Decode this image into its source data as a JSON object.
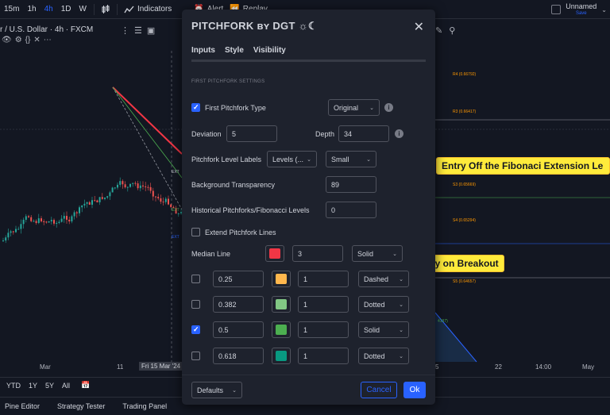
{
  "toolbar": {
    "timeframes": [
      "15m",
      "1h",
      "4h",
      "1D",
      "W"
    ],
    "active_timeframe": "4h",
    "indicators_label": "Indicators",
    "alert_label": "Alert",
    "replay_label": "Replay",
    "layout_name": "Unnamed",
    "layout_status": "Save"
  },
  "chart": {
    "symbol": "r / U.S. Dollar · 4h · FXCM",
    "levels": [
      {
        "label": "R4 (0.66792)",
        "color": "orange"
      },
      {
        "label": "R3 (0.66417)",
        "color": "orange"
      },
      {
        "label": "S3 (0.65669)",
        "color": "orange"
      },
      {
        "label": "S4 (0.65294)",
        "color": "orange"
      },
      {
        "label": "S5 (0.64657)",
        "color": "orange"
      },
      {
        "label": "4197)",
        "color": "green"
      }
    ],
    "pitchfork_labels": [
      "EXT",
      "EXT",
      "EXT"
    ],
    "notes": {
      "entry_off": "Entry Off the Fibonaci Extension Le",
      "entry_breakout": "try on Breakout"
    },
    "x_axis": [
      "Mar",
      "11",
      "Fri 15 Mar '24",
      "5",
      "22",
      "14:00",
      "May"
    ],
    "range_buttons": [
      "YTD",
      "1Y",
      "5Y",
      "All"
    ]
  },
  "bottom_panels": [
    "Pine Editor",
    "Strategy Tester",
    "Trading Panel"
  ],
  "dialog": {
    "title": "PITCHFORK ʙʏ DGT ☼☾",
    "tabs": [
      "Inputs",
      "Style",
      "Visibility"
    ],
    "active_tab": "Inputs",
    "section_title": "FIRST PITCHFORK SETTINGS",
    "first_pitchfork": {
      "label": "First Pitchfork Type",
      "checked": true,
      "type": "Original"
    },
    "deviation": {
      "label": "Deviation",
      "value": "5"
    },
    "depth": {
      "label": "Depth",
      "value": "34"
    },
    "level_labels": {
      "label": "Pitchfork Level Labels",
      "mode": "Levels (...",
      "size": "Small"
    },
    "background_transparency": {
      "label": "Background Transparency",
      "value": "89"
    },
    "historical": {
      "label": "Historical Pitchforks/Fibonacci Levels",
      "value": "0"
    },
    "extend": {
      "label": "Extend Pitchfork Lines",
      "checked": false
    },
    "median": {
      "label": "Median Line",
      "color": "#f23645",
      "width": "3",
      "style": "Solid"
    },
    "levels": [
      {
        "checked": false,
        "value": "0.25",
        "color": "#ffb74d",
        "width": "1",
        "style": "Dashed"
      },
      {
        "checked": false,
        "value": "0.382",
        "color": "#81c784",
        "width": "1",
        "style": "Dotted"
      },
      {
        "checked": true,
        "value": "0.5",
        "color": "#4caf50",
        "width": "1",
        "style": "Solid"
      },
      {
        "checked": false,
        "value": "0.618",
        "color": "#089981",
        "width": "1",
        "style": "Dotted"
      }
    ],
    "footer": {
      "defaults_label": "Defaults",
      "cancel_label": "Cancel",
      "ok_label": "Ok"
    }
  },
  "colors": {
    "accent": "#2962ff",
    "background": "#131722",
    "dialog_bg": "#1e222d",
    "note_bg": "#ffeb3b"
  }
}
